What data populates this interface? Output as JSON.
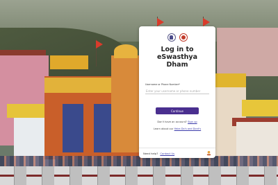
{
  "card": {
    "title": "Log in to eSwasthya Dham",
    "field_label": "Username or Phone Number*",
    "field_placeholder": "Enter your username or phone number",
    "field_value": "",
    "continue_label": "Continue",
    "signup_prompt": "Don't have an account?",
    "signup_link": "Sign up",
    "learn_prompt": "Learn about our",
    "learn_link": "Yatra Do's and Dont's",
    "help_prompt": "Need help?",
    "help_link": "Contact Us"
  },
  "colors": {
    "primary": "#4a2f8f",
    "link": "#3a3aaa",
    "flag": "#d93b2b",
    "temple": "#c95f2a"
  },
  "icons": {
    "left_logo": "india-emblem-icon",
    "right_logo": "state-seal-icon",
    "brand": "brand-mark-icon"
  }
}
